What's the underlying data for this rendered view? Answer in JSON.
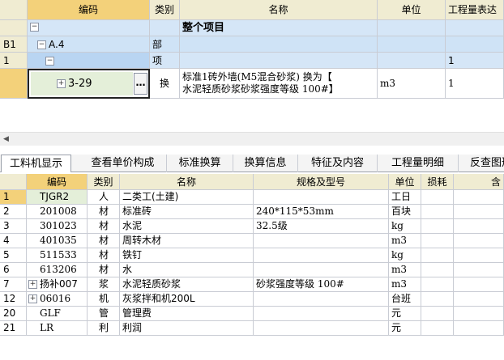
{
  "top_grid": {
    "headers": [
      "编码",
      "类别",
      "名称",
      "单位",
      "工程量表达"
    ],
    "rows": [
      {
        "num": "",
        "code": "",
        "type": "",
        "name": "整个项目",
        "unit": "",
        "qty": ""
      },
      {
        "num": "B1",
        "code": "A.4",
        "type": "部",
        "name": "",
        "unit": "",
        "qty": ""
      },
      {
        "num": "1",
        "code": "",
        "type": "项",
        "name": "",
        "unit": "",
        "qty": "1"
      },
      {
        "num": "",
        "code": "3-29",
        "type": "换",
        "name_line1": "标准1砖外墙(M5混合砂浆)  换为【",
        "name_line2": "水泥轻质砂浆砂浆强度等级 100#】",
        "unit": "m3",
        "qty": "1"
      }
    ],
    "more_button": "…"
  },
  "tabs": [
    "工料机显示",
    "查看单价构成",
    "标准换算",
    "换算信息",
    "特征及内容",
    "工程量明细",
    "反查图形"
  ],
  "bottom_grid": {
    "headers": [
      "编码",
      "类别",
      "名称",
      "规格及型号",
      "单位",
      "损耗",
      "含"
    ],
    "rows": [
      {
        "num": "1",
        "code": "TJGR2",
        "type": "人",
        "name": "二类工(土建)",
        "spec": "",
        "unit": "工日"
      },
      {
        "num": "2",
        "code": "201008",
        "type": "材",
        "name": "标准砖",
        "spec": "240*115*53mm",
        "unit": "百块"
      },
      {
        "num": "3",
        "code": "301023",
        "type": "材",
        "name": "水泥",
        "spec": "32.5级",
        "unit": "kg"
      },
      {
        "num": "4",
        "code": "401035",
        "type": "材",
        "name": "周转木材",
        "spec": "",
        "unit": "m3"
      },
      {
        "num": "5",
        "code": "511533",
        "type": "材",
        "name": "铁钉",
        "spec": "",
        "unit": "kg"
      },
      {
        "num": "6",
        "code": "613206",
        "type": "材",
        "name": "水",
        "spec": "",
        "unit": "m3"
      },
      {
        "num": "7",
        "code": "扬补007",
        "type": "浆",
        "name": "水泥轻质砂浆",
        "spec": "砂浆强度等级 100#",
        "unit": "m3"
      },
      {
        "num": "12",
        "code": "06016",
        "type": "机",
        "name": "灰浆拌和机200L",
        "spec": "",
        "unit": "台班"
      },
      {
        "num": "20",
        "code": "GLF",
        "type": "管",
        "name": "管理费",
        "spec": "",
        "unit": "元"
      },
      {
        "num": "21",
        "code": "LR",
        "type": "利",
        "name": "利润",
        "spec": "",
        "unit": "元"
      }
    ]
  },
  "colors": {
    "header_bg": "#f0ecd2",
    "selected_header": "#f3d17a",
    "row_blue": "#d5e6f7",
    "grid_line": "#c9ccd4"
  }
}
